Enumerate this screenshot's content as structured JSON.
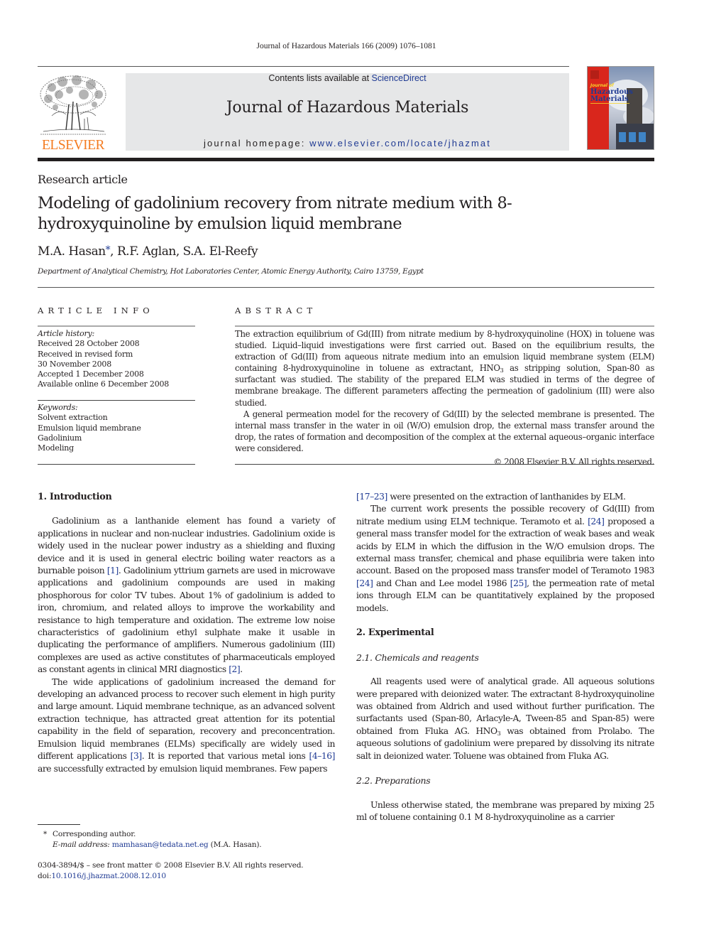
{
  "running_head": "Journal of Hazardous Materials 166 (2009) 1076–1081",
  "publisher": {
    "logo_word": "ELSEVIER",
    "logo_color": "#f47b20"
  },
  "masthead": {
    "contents_prefix": "Contents lists available at ",
    "contents_link": "ScienceDirect",
    "journal_title": "Journal of Hazardous Materials",
    "homepage_prefix": "journal homepage: ",
    "homepage_link": "www.elsevier.com/locate/jhazmat"
  },
  "cover": {
    "line1": "Journal of",
    "line2": "Hazardous",
    "line3": "Materials"
  },
  "article": {
    "type": "Research article",
    "title": "Modeling of gadolinium recovery from nitrate medium with 8-hydroxyquinoline by emulsion liquid membrane",
    "authors": [
      {
        "name": "M.A. Hasan",
        "mark": "*"
      },
      {
        "name": "R.F. Aglan",
        "mark": ""
      },
      {
        "name": "S.A. El-Reefy",
        "mark": ""
      }
    ],
    "affiliation": "Department of Analytical Chemistry, Hot Laboratories Center, Atomic Energy Authority, Cairo 13759, Egypt"
  },
  "article_info": {
    "heading": "ARTICLE INFO",
    "history_label": "Article history:",
    "history": [
      "Received 28 October 2008",
      "Received in revised form",
      "30 November 2008",
      "Accepted 1 December 2008",
      "Available online 6 December 2008"
    ],
    "keywords_label": "Keywords:",
    "keywords": [
      "Solvent extraction",
      "Emulsion liquid membrane",
      "Gadolinium",
      "Modeling"
    ]
  },
  "abstract": {
    "heading": "ABSTRACT",
    "p1_a": "The extraction equilibrium of Gd(III) from nitrate medium by 8-hydroxyquinoline (HOX) in toluene was studied. Liquid–liquid investigations were first carried out. Based on the equilibrium results, the extraction of Gd(III) from aqueous nitrate medium into an emulsion liquid membrane system (ELM) containing 8-hydroxyquinoline in toluene as extractant, HNO",
    "p1_sub": "3",
    "p1_b": " as stripping solution, Span-80 as surfactant was studied. The stability of the prepared ELM was studied in terms of the degree of membrane breakage. The different parameters affecting the permeation of gadolinium (III) were also studied.",
    "p2": "A general permeation model for the recovery of Gd(III) by the selected membrane is presented. The internal mass transfer in the water in oil (W/O) emulsion drop, the external mass transfer around the drop, the rates of formation and decomposition of the complex at the external aqueous–organic interface were considered.",
    "copyright": "© 2008 Elsevier B.V. All rights reserved."
  },
  "body": {
    "s1_heading": "1.  Introduction",
    "s1_p1_a": "Gadolinium as a lanthanide element has found a variety of applications in nuclear and non-nuclear industries. Gadolinium oxide is widely used in the nuclear power industry as a shielding and fluxing device and it is used in general electric boiling water reactors as a burnable poison ",
    "s1_p1_ref1": "[1]",
    "s1_p1_b": ". Gadolinium yttrium garnets are used in microwave applications and gadolinium compounds are used in making phosphorous for color TV tubes. About 1% of gadolinium is added to iron, chromium, and related alloys to improve the workability and resistance to high temperature and oxidation. The extreme low noise characteristics of gadolinium ethyl sulphate make it usable in duplicating the performance of amplifiers. Numerous gadolinium (III) complexes are used as active constitutes of pharmaceuticals employed as constant agents in clinical MRI diagnostics ",
    "s1_p1_ref2": "[2]",
    "s1_p1_c": ".",
    "s1_p2_a": "The wide applications of gadolinium increased the demand for developing an advanced process to recover such element in high purity and large amount. Liquid membrane technique, as an advanced solvent extraction technique, has attracted great attention for its potential capability in the field of separation, recovery and preconcentration. Emulsion liquid membranes (ELMs) specifically are widely used in different applications ",
    "s1_p2_ref1": "[3]",
    "s1_p2_b": ". It is reported that various metal ions ",
    "s1_p2_ref2": "[4–16]",
    "s1_p2_c": " are successfully extracted by emulsion liquid membranes. Few papers ",
    "s1_p2_ref3": "[17–23]",
    "s1_p2_d": " were presented on the extraction of lanthanides by ELM.",
    "s1_p3_a": "The current work presents the possible recovery of Gd(III) from nitrate medium using ELM technique. Teramoto et al. ",
    "s1_p3_ref1": "[24]",
    "s1_p3_b": " proposed a general mass transfer model for the extraction of weak bases and weak acids by ELM in which the diffusion in the W/O emulsion drops. The external mass transfer, chemical and phase equilibria were taken into account. Based on the proposed mass transfer model of Teramoto 1983 ",
    "s1_p3_ref2": "[24]",
    "s1_p3_c": " and Chan and Lee model 1986 ",
    "s1_p3_ref3": "[25]",
    "s1_p3_d": ", the permeation rate of metal ions through ELM can be quantitatively explained by the proposed models.",
    "s2_heading": "2.  Experimental",
    "s21_heading": "2.1.  Chemicals and reagents",
    "s21_p1_a": "All reagents used were of analytical grade. All aqueous solutions were prepared with deionized water. The extractant 8-hydroxyquinoline was obtained from Aldrich and used without further purification. The surfactants used (Span-80, Arlacyle-A, Tween-85 and Span-85) were obtained from Fluka AG. HNO",
    "s21_p1_sub": "3",
    "s21_p1_b": " was obtained from Prolabo. The aqueous solutions of gadolinium were prepared by dissolving its nitrate salt in deionized water. Toluene was obtained from Fluka AG.",
    "s22_heading": "2.2.  Preparations",
    "s22_p1": "Unless otherwise stated, the membrane was prepared by mixing 25 ml of toluene containing 0.1 M 8-hydroxyquinoline as a carrier"
  },
  "footnote": {
    "mark": "*",
    "corresponding": "Corresponding author.",
    "email_label": "E-mail address: ",
    "email": "mamhasan@tedata.net.eg",
    "email_suffix": " (M.A. Hasan)."
  },
  "front_matter": {
    "issn_line": "0304-3894/$ – see front matter © 2008 Elsevier B.V. All rights reserved.",
    "doi_label": "doi:",
    "doi": "10.1016/j.jhazmat.2008.12.010"
  }
}
